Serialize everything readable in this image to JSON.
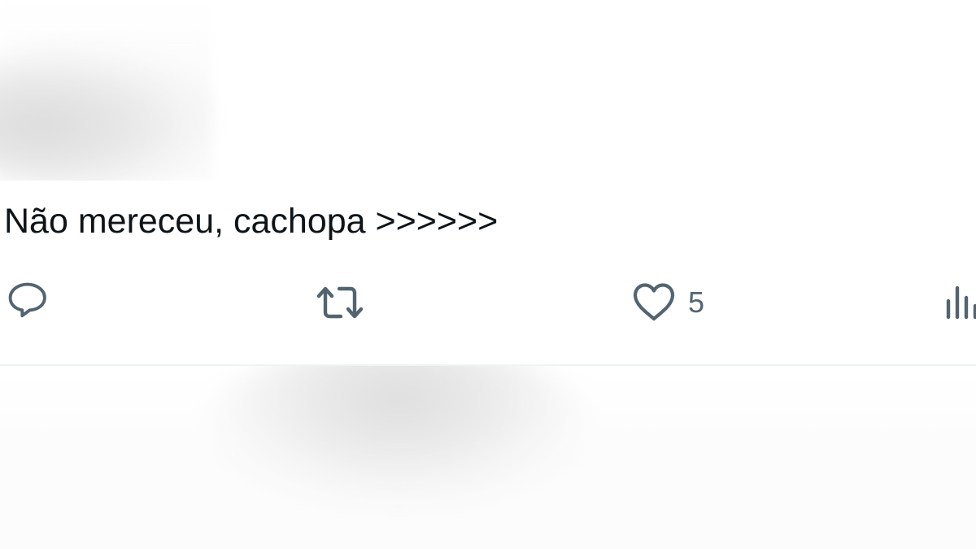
{
  "tweet": {
    "text": "Não mereceu, cachopa >>>>>>",
    "actions": {
      "reply": {
        "icon": "reply-icon",
        "count": ""
      },
      "retweet": {
        "icon": "retweet-icon",
        "count": ""
      },
      "like": {
        "icon": "heart-icon",
        "count": "5"
      },
      "views": {
        "icon": "views-icon",
        "count": ""
      }
    }
  },
  "colors": {
    "text": "#0f1419",
    "icon": "#536471",
    "divider": "#eff3f4",
    "background": "#ffffff"
  }
}
